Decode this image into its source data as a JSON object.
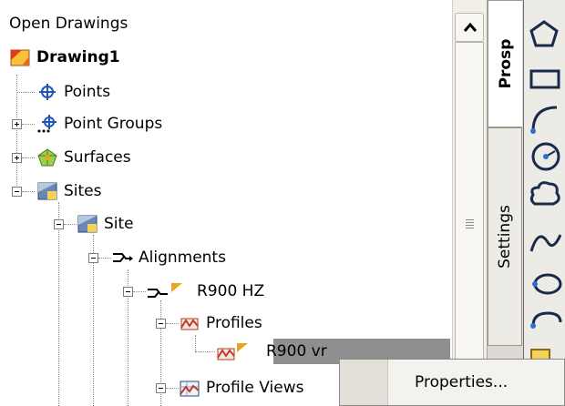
{
  "tree": {
    "header": "Open Drawings",
    "nodes": [
      {
        "label": "Drawing1",
        "bold": true
      },
      {
        "label": "Points"
      },
      {
        "label": "Point Groups"
      },
      {
        "label": "Surfaces"
      },
      {
        "label": "Sites"
      },
      {
        "label": "Site"
      },
      {
        "label": "Alignments"
      },
      {
        "label": "R900 HZ"
      },
      {
        "label": "Profiles"
      },
      {
        "label": "R900 vr",
        "selected": true
      },
      {
        "label": "Profile Views"
      }
    ]
  },
  "tabs": {
    "prospector": "Prosp",
    "settings": "Settings"
  },
  "context_menu": {
    "items": [
      {
        "label": "Properties..."
      }
    ]
  },
  "colors": {
    "selected_bg": "#8f8f8f",
    "panel_bg": "#ecebe6"
  }
}
